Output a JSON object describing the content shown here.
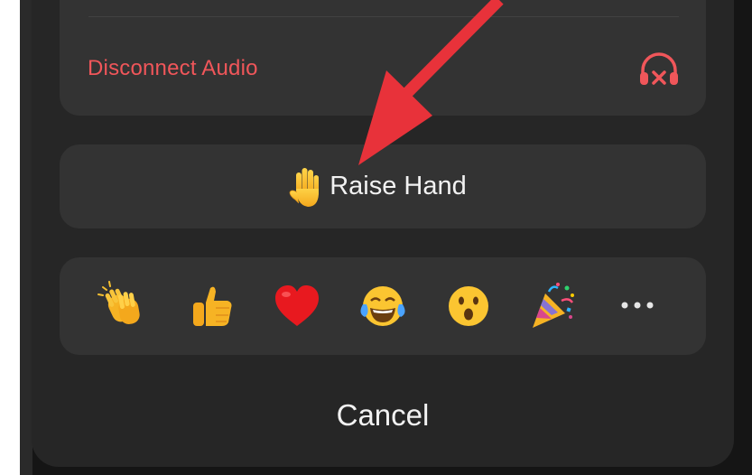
{
  "sheet": {
    "disconnect_audio": {
      "label": "Disconnect Audio",
      "icon": "headphones-x-icon",
      "color": "#f0565a"
    },
    "raise_hand": {
      "label": "Raise Hand",
      "icon": "raised-hand-icon"
    },
    "reactions": [
      {
        "name": "clapping-hands"
      },
      {
        "name": "thumbs-up"
      },
      {
        "name": "red-heart"
      },
      {
        "name": "tears-of-joy"
      },
      {
        "name": "open-mouth"
      },
      {
        "name": "party-popper"
      }
    ],
    "more_reactions_icon": "ellipsis-icon",
    "cancel": {
      "label": "Cancel"
    }
  },
  "annotation": {
    "type": "red-arrow",
    "points_to": "Raise Hand",
    "color": "#e8323a"
  }
}
